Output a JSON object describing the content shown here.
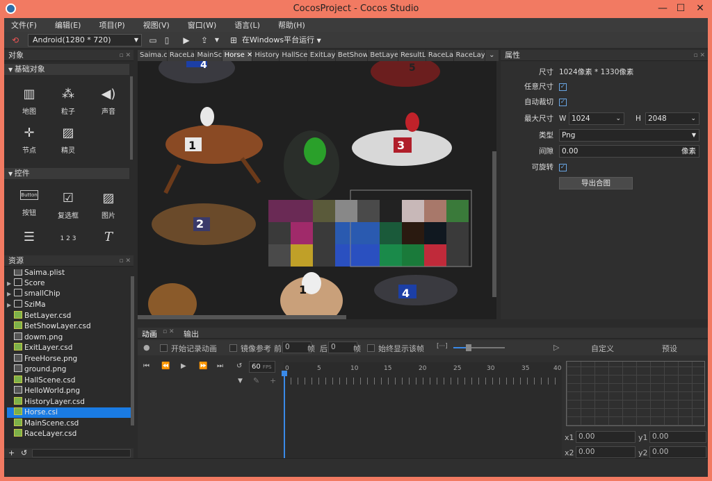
{
  "window": {
    "title": "CocosProject - Cocos Studio"
  },
  "menu": [
    "文件(F)",
    "编辑(E)",
    "项目(P)",
    "视图(V)",
    "窗口(W)",
    "语言(L)",
    "帮助(H)"
  ],
  "toolbar": {
    "resolution": "Android(1280 * 720)",
    "run_target": "在Windows平台运行"
  },
  "objects_panel": {
    "title": "对象",
    "basic_section": "基础对象",
    "basic_items": [
      "地图",
      "粒子",
      "声音",
      "节点",
      "精灵"
    ],
    "controls_section": "控件",
    "control_items": [
      "按钮",
      "复选框",
      "图片"
    ]
  },
  "resources_panel": {
    "title": "资源",
    "items": [
      {
        "name": "Saima.plist",
        "type": "file"
      },
      {
        "name": "Score",
        "type": "folder"
      },
      {
        "name": "smallChip",
        "type": "folder"
      },
      {
        "name": "SziMa",
        "type": "folder"
      },
      {
        "name": "BetLayer.csd",
        "type": "csd"
      },
      {
        "name": "BetShowLayer.csd",
        "type": "csd"
      },
      {
        "name": "dowm.png",
        "type": "img"
      },
      {
        "name": "ExitLayer.csd",
        "type": "csd"
      },
      {
        "name": "FreeHorse.png",
        "type": "img"
      },
      {
        "name": "ground.png",
        "type": "img"
      },
      {
        "name": "HallScene.csd",
        "type": "csd"
      },
      {
        "name": "HelloWorld.png",
        "type": "img"
      },
      {
        "name": "HistoryLayer.csd",
        "type": "csd"
      },
      {
        "name": "Horse.csi",
        "type": "csd",
        "selected": true
      },
      {
        "name": "MainScene.csd",
        "type": "csd"
      },
      {
        "name": "RaceLayer.csd",
        "type": "csd"
      }
    ]
  },
  "tabs": [
    {
      "label": "Saima.c"
    },
    {
      "label": "RaceLa"
    },
    {
      "label": "MainSc"
    },
    {
      "label": "Horse",
      "active": true
    },
    {
      "label": "History"
    },
    {
      "label": "HallSce"
    },
    {
      "label": "ExitLay"
    },
    {
      "label": "BetShow"
    },
    {
      "label": "BetLaye"
    },
    {
      "label": "ResultL"
    },
    {
      "label": "RaceLa"
    },
    {
      "label": "RaceLay"
    }
  ],
  "properties": {
    "title": "属性",
    "size_label": "尺寸",
    "size_value": "1024像素 * 1330像素",
    "arbitrary_size_label": "任意尺寸",
    "auto_crop_label": "自动裁切",
    "max_size_label": "最大尺寸",
    "w_label": "W",
    "w_value": "1024",
    "h_label": "H",
    "h_value": "2048",
    "type_label": "类型",
    "type_value": "Png",
    "spacing_label": "间隙",
    "spacing_value": "0.00",
    "spacing_unit": "像素",
    "rotatable_label": "可旋转",
    "export_button": "导出合图"
  },
  "animation": {
    "tab_anim": "动画",
    "tab_output": "输出",
    "record_label": "开始记录动画",
    "onion_label": "镜像参考",
    "before_label": "前",
    "before_value": "0",
    "frame_unit": "帧",
    "after_label": "后",
    "after_value": "0",
    "always_show_label": "始终显示该帧",
    "fps_value": "60",
    "fps_label": "FPS",
    "custom_label": "自定义",
    "preset_label": "预设",
    "ticks": [
      "0",
      "5",
      "10",
      "15",
      "20",
      "25",
      "30",
      "35",
      "40"
    ],
    "x1_label": "x1",
    "x1_value": "0.00",
    "y1_label": "y1",
    "y1_value": "0.00",
    "x2_label": "x2",
    "x2_value": "0.00",
    "y2_label": "y2",
    "y2_value": "0.00"
  },
  "horse_numbers": [
    "4",
    "5",
    "1",
    "3",
    "2",
    "1",
    "4"
  ],
  "colors": {
    "titlebar": "#f27a62",
    "selection": "#1a7be3",
    "accent": "#6aa7e6"
  }
}
